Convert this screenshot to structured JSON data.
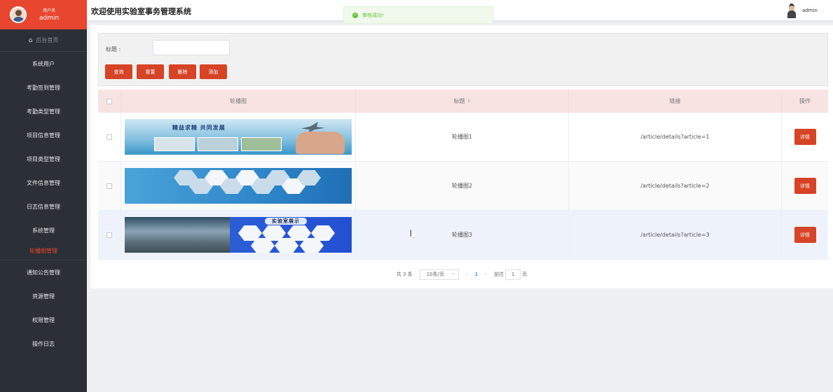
{
  "sidebar": {
    "user_role": "用户名",
    "user_name": "admin",
    "home_label": "后台首页",
    "items": [
      {
        "label": "系统用户"
      },
      {
        "label": "考勤签到管理"
      },
      {
        "label": "考勤类型管理"
      },
      {
        "label": "项目信息管理"
      },
      {
        "label": "项目类型管理"
      },
      {
        "label": "文件信息管理"
      },
      {
        "label": "日志信息管理"
      },
      {
        "label": "系统管理"
      },
      {
        "label": "轮播图管理",
        "active": true
      },
      {
        "label": "通知公告管理"
      },
      {
        "label": "资源管理"
      },
      {
        "label": "权限管理"
      },
      {
        "label": "操作日志"
      }
    ]
  },
  "header": {
    "title": "欢迎使用实验室事务管理系统",
    "username": "admin"
  },
  "toast": {
    "message": "审核成功!",
    "color": "#67c23a"
  },
  "search": {
    "title_label": "标题 :",
    "title_value": "",
    "buttons": {
      "query": "查询",
      "reset": "重置",
      "delete": "删除",
      "add": "添加"
    }
  },
  "table": {
    "headers": {
      "image": "轮播图",
      "title": "标题",
      "link": "链接",
      "action": "操作"
    },
    "rows": [
      {
        "title": "轮播图1",
        "link": "/article/details?article=1",
        "action": "详情",
        "banner_text": "精益求精 共同发展"
      },
      {
        "title": "轮播图2",
        "link": "/article/details?article=2",
        "action": "详情",
        "banner_text": ""
      },
      {
        "title": "轮播图3",
        "link": "/article/details?article=3",
        "action": "详情",
        "banner_text": "实验室展示"
      }
    ]
  },
  "pagination": {
    "total": "共 3 条",
    "page_size": "10条/页",
    "prev": "‹",
    "current_page": "1",
    "next": "›",
    "goto_label": "前往",
    "goto_value": "1",
    "page_suffix": "页"
  },
  "colors": {
    "accent": "#d64326",
    "sidebar_bg": "#2b2f36",
    "user_box_bg": "#e8462e",
    "header_row_bg": "#f6e3e2"
  }
}
